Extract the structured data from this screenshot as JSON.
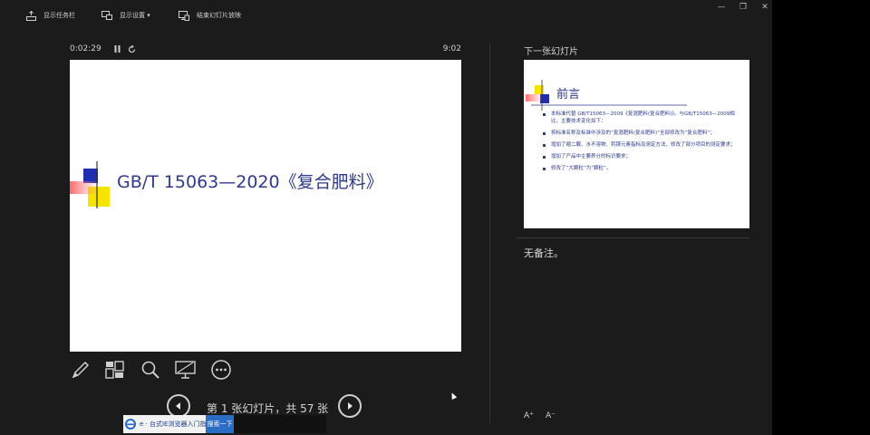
{
  "toolbar": {
    "taskbar_label": "显示任务栏",
    "display_settings_label": "显示设置 ▾",
    "end_show_label": "结束幻灯片放映"
  },
  "window": {
    "minimize": "—",
    "restore": "❐",
    "close": "✕"
  },
  "presenter": {
    "elapsed_time": "0:02:29",
    "clock": "9:02",
    "slide_counter": "第 1 张幻灯片，共 57 张"
  },
  "current_slide": {
    "title": "GB/T 15063—2020《复合肥料》"
  },
  "next_slide": {
    "label": "下一张幻灯片",
    "title": "前言",
    "bullets": [
      "本标准代替 GB/T15063—2009《复混肥料(复合肥料)》。与GB/T15063—2009相比，主要技术变化如下：",
      "将标准名称及标准中涉及的“复混肥料(复合肥料)”全部修改为“复合肥料”；",
      "增加了缩二脲、水不溶物、钙镁元素指标及测定方法，修改了部分项目的测定要求；",
      "增加了产品中主要养分的标识要求；",
      "修改了“大颗粒”为“颗粒”。"
    ]
  },
  "notes": {
    "text": "无备注。"
  },
  "font_controls": {
    "increase": "A⁺",
    "decrease": "A⁻"
  },
  "ad": {
    "text": "e · 台式IE浏览器入门指南",
    "button": "搜索一下"
  },
  "colors": {
    "background": "#1b1b1b",
    "slide_title": "#2e3a8c",
    "accent_blue": "#2b6cc4"
  },
  "icons": {
    "taskbar": "taskbar-icon",
    "display_settings": "monitor-icon",
    "end_show": "end-show-icon",
    "pen": "pen-icon",
    "all_slides": "grid-icon",
    "zoom": "magnifier-icon",
    "black_screen": "screen-icon",
    "more": "more-icon"
  }
}
